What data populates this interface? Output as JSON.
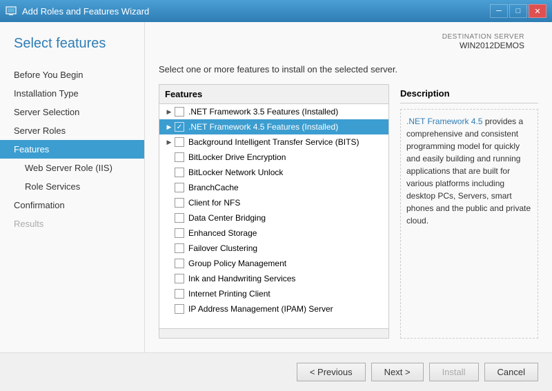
{
  "window": {
    "title": "Add Roles and Features Wizard",
    "icon": "server-icon"
  },
  "titlebar_controls": {
    "minimize": "─",
    "maximize": "□",
    "close": "✕"
  },
  "sidebar": {
    "title": "Select features",
    "items": [
      {
        "id": "before-you-begin",
        "label": "Before You Begin",
        "active": false,
        "indented": false,
        "disabled": false
      },
      {
        "id": "installation-type",
        "label": "Installation Type",
        "active": false,
        "indented": false,
        "disabled": false
      },
      {
        "id": "server-selection",
        "label": "Server Selection",
        "active": false,
        "indented": false,
        "disabled": false
      },
      {
        "id": "server-roles",
        "label": "Server Roles",
        "active": false,
        "indented": false,
        "disabled": false
      },
      {
        "id": "features",
        "label": "Features",
        "active": true,
        "indented": false,
        "disabled": false
      },
      {
        "id": "web-server-role",
        "label": "Web Server Role (IIS)",
        "active": false,
        "indented": true,
        "disabled": false
      },
      {
        "id": "role-services",
        "label": "Role Services",
        "active": false,
        "indented": true,
        "disabled": false
      },
      {
        "id": "confirmation",
        "label": "Confirmation",
        "active": false,
        "indented": false,
        "disabled": false
      },
      {
        "id": "results",
        "label": "Results",
        "active": false,
        "indented": false,
        "disabled": true
      }
    ]
  },
  "destination_server": {
    "label": "DESTINATION SERVER",
    "name": "WIN2012DEMOS"
  },
  "content": {
    "instruction": "Select one or more features to install on the selected server.",
    "features_header": "Features",
    "description_header": "Description",
    "description_text_parts": [
      ".NET Framework 4.5",
      " provides a comprehensive and consistent programming model for quickly and easily building and running applications that are built for various platforms including desktop PCs, Servers, smart phones and the public and private cloud."
    ],
    "features": [
      {
        "id": "dotnet35",
        "label": ".NET Framework 3.5 Features (Installed)",
        "expandable": true,
        "checked": false,
        "selected": false,
        "indent": 0
      },
      {
        "id": "dotnet45",
        "label": ".NET Framework 4.5 Features (Installed)",
        "expandable": true,
        "checked": true,
        "selected": true,
        "indent": 0
      },
      {
        "id": "bits",
        "label": "Background Intelligent Transfer Service (BITS)",
        "expandable": true,
        "checked": false,
        "selected": false,
        "indent": 0
      },
      {
        "id": "bitlocker",
        "label": "BitLocker Drive Encryption",
        "expandable": false,
        "checked": false,
        "selected": false,
        "indent": 0
      },
      {
        "id": "bitlocker-network",
        "label": "BitLocker Network Unlock",
        "expandable": false,
        "checked": false,
        "selected": false,
        "indent": 0
      },
      {
        "id": "branchcache",
        "label": "BranchCache",
        "expandable": false,
        "checked": false,
        "selected": false,
        "indent": 0
      },
      {
        "id": "nfs-client",
        "label": "Client for NFS",
        "expandable": false,
        "checked": false,
        "selected": false,
        "indent": 0
      },
      {
        "id": "datacenter-bridging",
        "label": "Data Center Bridging",
        "expandable": false,
        "checked": false,
        "selected": false,
        "indent": 0
      },
      {
        "id": "enhanced-storage",
        "label": "Enhanced Storage",
        "expandable": false,
        "checked": false,
        "selected": false,
        "indent": 0
      },
      {
        "id": "failover-clustering",
        "label": "Failover Clustering",
        "expandable": false,
        "checked": false,
        "selected": false,
        "indent": 0
      },
      {
        "id": "group-policy",
        "label": "Group Policy Management",
        "expandable": false,
        "checked": false,
        "selected": false,
        "indent": 0
      },
      {
        "id": "ink-handwriting",
        "label": "Ink and Handwriting Services",
        "expandable": false,
        "checked": false,
        "selected": false,
        "indent": 0
      },
      {
        "id": "internet-printing",
        "label": "Internet Printing Client",
        "expandable": false,
        "checked": false,
        "selected": false,
        "indent": 0
      },
      {
        "id": "ipam",
        "label": "IP Address Management (IPAM) Server",
        "expandable": false,
        "checked": false,
        "selected": false,
        "indent": 0
      }
    ]
  },
  "buttons": {
    "previous": "< Previous",
    "next": "Next >",
    "install": "Install",
    "cancel": "Cancel"
  },
  "colors": {
    "accent": "#3c9dd0",
    "titlebar": "#2e7db5",
    "link": "#2e7db5"
  }
}
